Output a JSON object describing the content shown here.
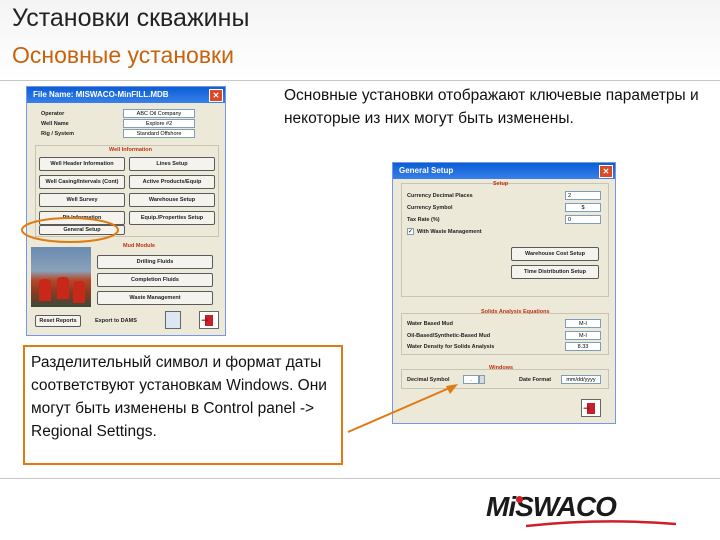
{
  "slide": {
    "title": "Установки скважины",
    "subtitle": "Основные установки",
    "description": "Основные установки отображают ключевые параметры и некоторые из них могут быть изменены.",
    "note": "Разделительный символ и формат даты соответствуют установкам Windows. Они могут быть изменены в Control panel -> Regional Settings.",
    "colors": {
      "accent": "#e07a12",
      "title_orange": "#c8620c",
      "xp_blue": "#0a5ed7"
    }
  },
  "main_window": {
    "title": "File Name: MISWACO-MinFILL.MDB",
    "operator_label": "Operator",
    "operator_value": "ABC Oil Company",
    "well_name_label": "Well Name",
    "well_name_value": "Explore #2",
    "rig_label": "Rig / System",
    "rig_value": "Standard Offshore",
    "well_info_header": "Well Information",
    "buttons": [
      "Well Header Information",
      "Lines Setup",
      "Well Casing/Intervals (Cont)",
      "Active Products/Equip",
      "Well Survey",
      "Warehouse Setup",
      "Pit Information",
      "Equip./Properties Setup",
      "General Setup"
    ],
    "mud_header": "Mud Module",
    "mud_buttons": [
      "Drilling Fluids",
      "Completion Fluids",
      "Waste Management"
    ],
    "footer_left": "Reset Reports",
    "footer_mid": "Export to DAMS",
    "icon_names": [
      "exit-icon",
      "well-photo"
    ]
  },
  "setup_window": {
    "title": "General Setup",
    "setup_header": "Setup",
    "currency_decimal_label": "Currency Decimal Places",
    "currency_decimal_value": "2",
    "currency_symbol_label": "Currency Symbol",
    "currency_symbol_value": "$",
    "tax_rate_label": "Tax Rate (%)",
    "tax_rate_value": "0",
    "waste_checkbox_label": "With Waste Management",
    "warehouse_cost_button": "Warehouse Cost Setup",
    "time_dist_button": "Time Distribution Setup",
    "solids_header": "Solids Analysis Equations",
    "water_mud_label": "Water Based Mud",
    "water_mud_value": "M-I",
    "oil_mud_label": "Oil-Based/Synthetic-Based Mud",
    "oil_mud_value": "M-I",
    "water_density_label": "Water Density for Solids Analysis",
    "water_density_value": "8.33",
    "windows_header": "Windows",
    "decimal_symbol_label": "Decimal Symbol",
    "decimal_symbol_value": ".",
    "date_format_label": "Date Format",
    "date_format_value": "mm/dd/yyyy"
  },
  "logo": {
    "text": "MiSWACO"
  }
}
